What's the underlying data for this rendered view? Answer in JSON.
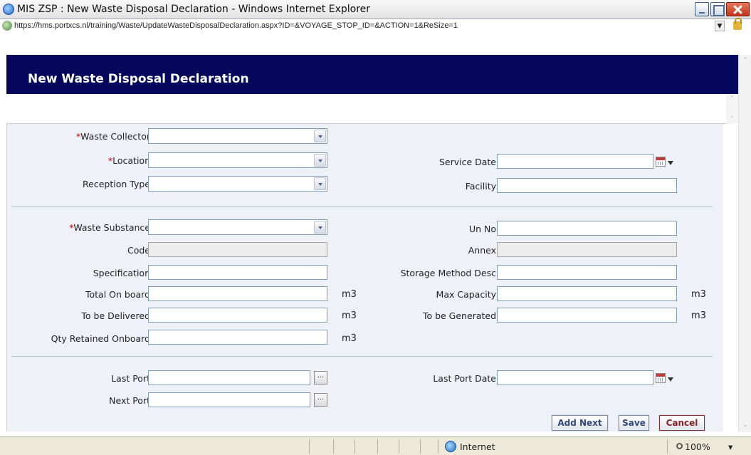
{
  "window": {
    "title": "MIS ZSP : New Waste Disposal Declaration - Windows Internet Explorer",
    "url": "https://hms.portxcs.nl/training/Waste/UpdateWasteDisposalDeclaration.aspx?ID=&VOYAGE_STOP_ID=&ACTION=1&ReSize=1"
  },
  "page": {
    "title": "New Waste Disposal Declaration"
  },
  "section1": {
    "waste_collector": {
      "label": "Waste Collector",
      "required": "*",
      "value": ""
    },
    "location": {
      "label": "Location",
      "required": "*",
      "value": ""
    },
    "reception_type": {
      "label": "Reception Type",
      "value": ""
    },
    "service_date": {
      "label": "Service Date",
      "value": ""
    },
    "facility": {
      "label": "Facility",
      "value": ""
    }
  },
  "section2": {
    "waste_substance": {
      "label": "Waste Substance",
      "required": "*",
      "value": ""
    },
    "code": {
      "label": "Code",
      "value": ""
    },
    "specification": {
      "label": "Specification",
      "value": ""
    },
    "total_on_board": {
      "label": "Total On board",
      "value": "",
      "unit": "m3"
    },
    "to_be_delivered": {
      "label": "To be Delivered",
      "value": "",
      "unit": "m3"
    },
    "qty_retained": {
      "label": "Qty Retained Onboard",
      "value": "",
      "unit": "m3"
    },
    "un_no": {
      "label": "Un No",
      "value": ""
    },
    "annex": {
      "label": "Annex",
      "value": ""
    },
    "storage_method": {
      "label": "Storage Method Desc",
      "value": ""
    },
    "max_capacity": {
      "label": "Max Capacity",
      "value": "",
      "unit": "m3"
    },
    "to_be_generated": {
      "label": "To be Generated",
      "value": "",
      "unit": "m3"
    }
  },
  "section3": {
    "last_port": {
      "label": "Last Port",
      "value": "",
      "lookup": "..."
    },
    "next_port": {
      "label": "Next Port",
      "value": "",
      "lookup": "..."
    },
    "last_port_date": {
      "label": "Last Port Date",
      "value": ""
    }
  },
  "buttons": {
    "add_next": "Add Next",
    "save": "Save",
    "cancel": "Cancel"
  },
  "statusbar": {
    "zone": "Internet",
    "zoom": "100%",
    "zoom_dd": "▾"
  },
  "icons": {
    "ie": "ie-logo-icon",
    "lock": "lock-icon",
    "calendar": "calendar-icon",
    "globe": "globe-icon"
  },
  "colors": {
    "header_bg": "#04075c",
    "form_bg": "#eef2f8",
    "required": "#c00000"
  }
}
